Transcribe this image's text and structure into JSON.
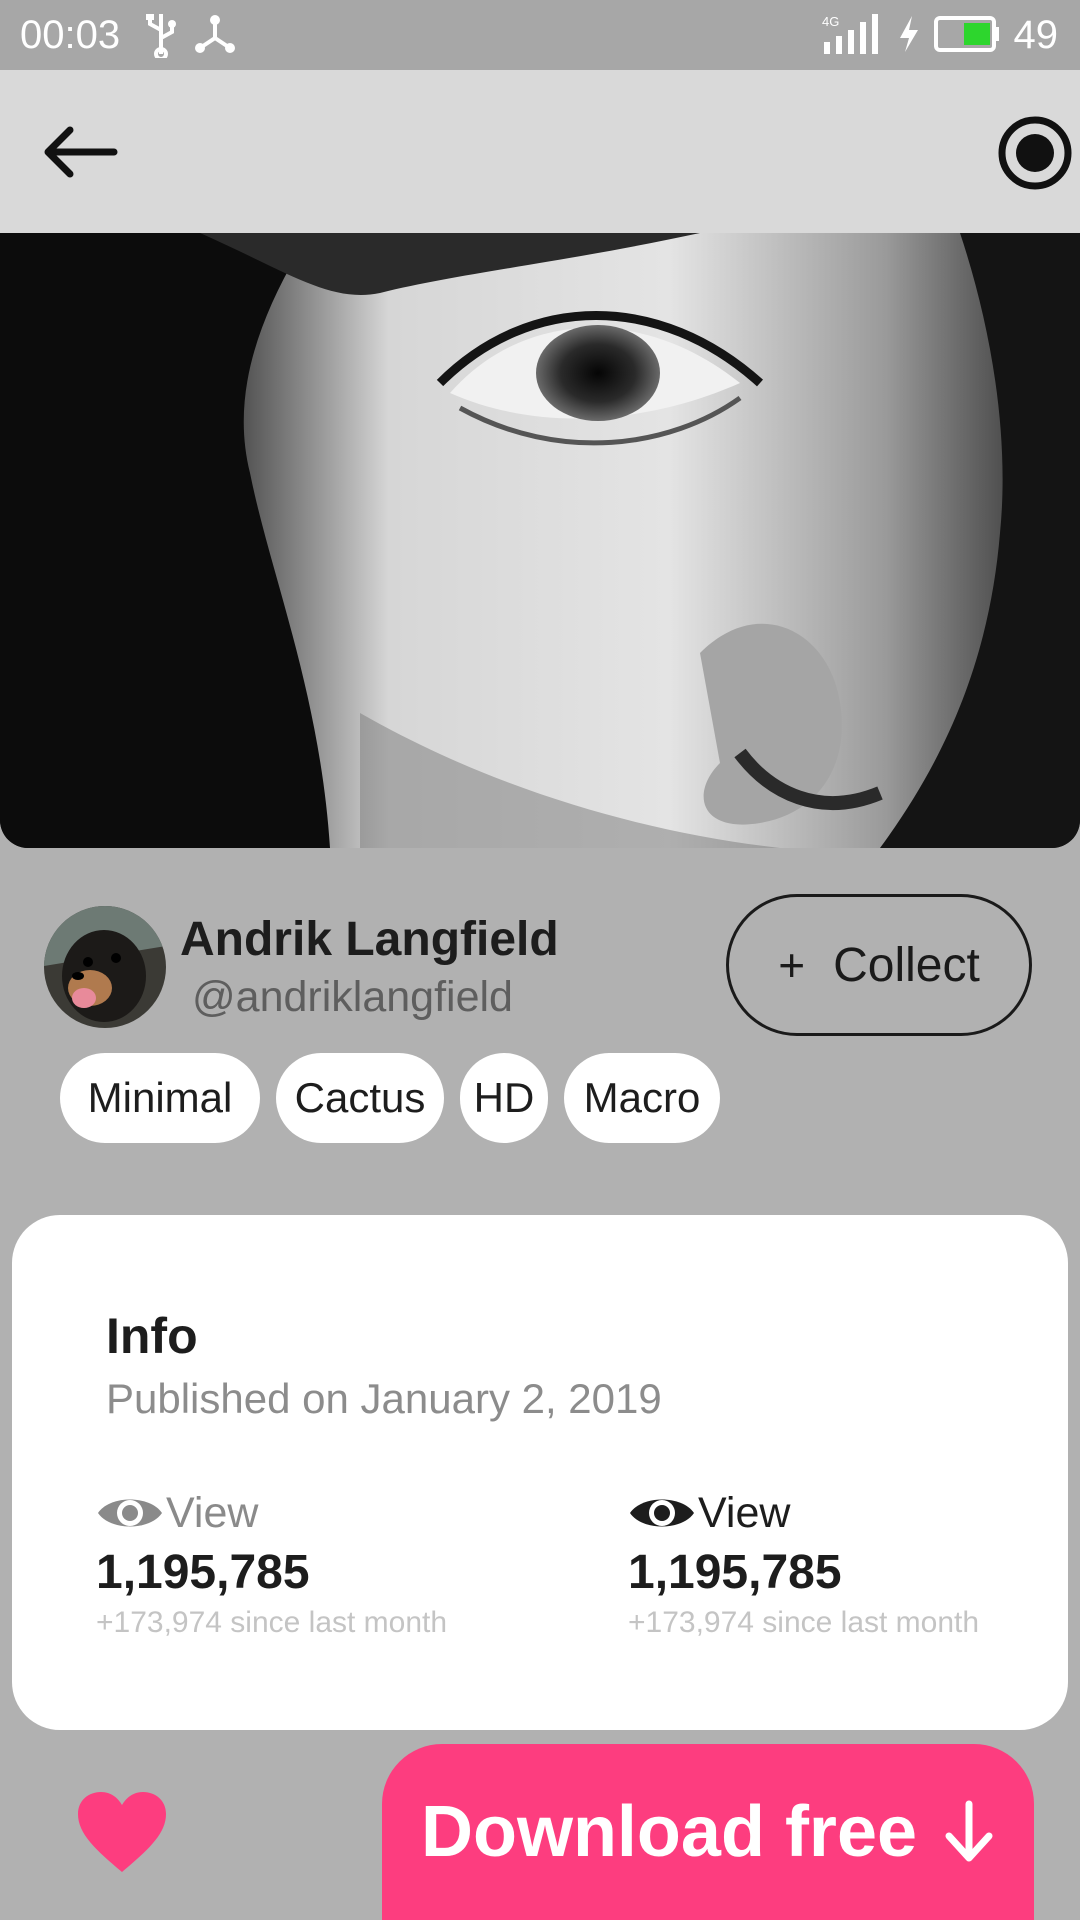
{
  "status_bar": {
    "time": "00:03",
    "network": "4G",
    "battery": "49",
    "icons": [
      "usb-icon",
      "share-hub-icon",
      "signal-icon",
      "charging-icon",
      "battery-icon"
    ]
  },
  "app_bar": {
    "back_icon": "arrow-left-icon",
    "action_icon": "record-icon"
  },
  "photo": {
    "subject": "black-and-white close-up portrait"
  },
  "author": {
    "name": "Andrik Langfield",
    "handle": "@andriklangfield",
    "avatar": "dog-avatar"
  },
  "collect_button": {
    "icon": "+",
    "label": "Collect"
  },
  "tags": [
    "Minimal",
    "Cactus",
    "HD",
    "Macro"
  ],
  "info": {
    "title": "Info",
    "published": "Published on January 2, 2019",
    "stats": [
      {
        "icon": "eye-icon",
        "label": "View",
        "value": "1,195,785",
        "delta": "+173,974 since last month",
        "color": "#8a8a8a"
      },
      {
        "icon": "eye-icon",
        "label": "View",
        "value": "1,195,785",
        "delta": "+173,974 since last month",
        "color": "#1d1d1d"
      }
    ]
  },
  "actions": {
    "like_icon": "heart-icon",
    "download_label": "Download free",
    "download_icon": "arrow-down-icon",
    "accent": "#fd3d7f"
  }
}
